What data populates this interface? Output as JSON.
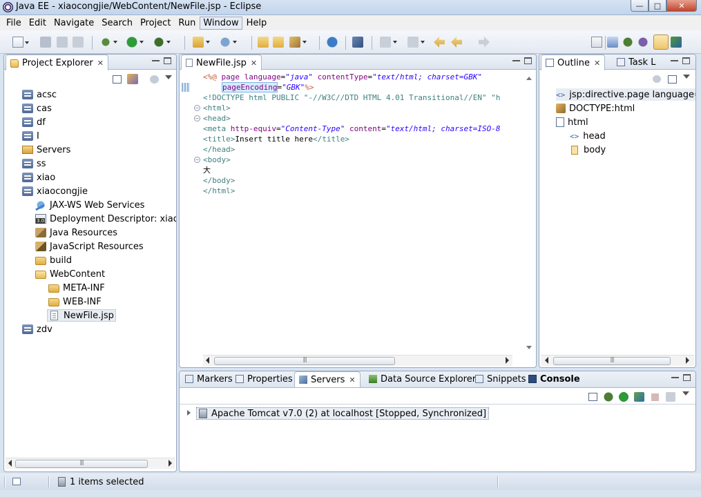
{
  "window": {
    "title": "Java EE - xiaocongjie/WebContent/NewFile.jsp - Eclipse",
    "minimize": "—",
    "maximize": "□",
    "close": "✕"
  },
  "menu": [
    "File",
    "Edit",
    "Navigate",
    "Search",
    "Project",
    "Run",
    "Window",
    "Help"
  ],
  "project_explorer": {
    "tab_label": "Project Explorer",
    "items": [
      {
        "label": "acsc"
      },
      {
        "label": "cas"
      },
      {
        "label": "df"
      },
      {
        "label": "I"
      },
      {
        "label": "Servers"
      },
      {
        "label": "ss"
      },
      {
        "label": "xiao"
      },
      {
        "label": "xiaocongjie"
      },
      {
        "label": "JAX-WS Web Services"
      },
      {
        "label": "Deployment Descriptor: xiaocongjie"
      },
      {
        "label": "Java Resources"
      },
      {
        "label": "JavaScript Resources"
      },
      {
        "label": "build"
      },
      {
        "label": "WebContent"
      },
      {
        "label": "META-INF"
      },
      {
        "label": "WEB-INF"
      },
      {
        "label": "NewFile.jsp"
      },
      {
        "label": "zdv"
      }
    ]
  },
  "editor": {
    "tab_label": "NewFile.jsp",
    "lines": {
      "l1": {
        "open": "<%@ ",
        "kw": "page ",
        "a1": "language",
        "eq1": "=",
        "v1": "\"java\"",
        "a2": " contentType",
        "eq2": "=",
        "v2": "\"text/html; charset=GBK\""
      },
      "l2": {
        "a1": "pageEncoding",
        "eq1": "=",
        "v1": "\"GBK\"",
        "close": "%>"
      },
      "l3": {
        "text": "<!DOCTYPE html PUBLIC \"-//W3C//DTD HTML 4.01 Transitional//EN\" \"h"
      },
      "l4": {
        "text": "<html>"
      },
      "l5": {
        "text": "<head>"
      },
      "l6": {
        "tag": "<meta ",
        "a1": "http-equiv",
        "eq1": "=",
        "v1": "\"Content-Type\"",
        "a2": " content",
        "eq2": "=",
        "v2": "\"text/html; charset=ISO-8"
      },
      "l7": {
        "open": "<title>",
        "text": "Insert title here",
        "close": "</title>"
      },
      "l8": {
        "text": "</head>"
      },
      "l9": {
        "text": "<body>"
      },
      "l10": {
        "text": "大"
      },
      "l11": {
        "text": "</body>"
      },
      "l12": {
        "text": "</html>"
      }
    }
  },
  "outline": {
    "tab_label": "Outline",
    "task_tab_label": "Task L",
    "items": [
      {
        "label": "jsp:directive.page language=java"
      },
      {
        "label": "DOCTYPE:html"
      },
      {
        "label": "html"
      },
      {
        "label": "head"
      },
      {
        "label": "body"
      }
    ]
  },
  "bottom": {
    "tabs": [
      {
        "label": "Markers"
      },
      {
        "label": "Properties"
      },
      {
        "label": "Servers"
      },
      {
        "label": "Data Source Explorer"
      },
      {
        "label": "Snippets"
      },
      {
        "label": "Console"
      }
    ],
    "server_entry": "Apache Tomcat v7.0 (2) at localhost  [Stopped, Synchronized]"
  },
  "status": {
    "text": "1 items selected"
  },
  "colors": {
    "tag": "#3f7f7f",
    "attribute": "#7f007f",
    "value": "#2a00ff",
    "directive": "#bf5f3f"
  }
}
